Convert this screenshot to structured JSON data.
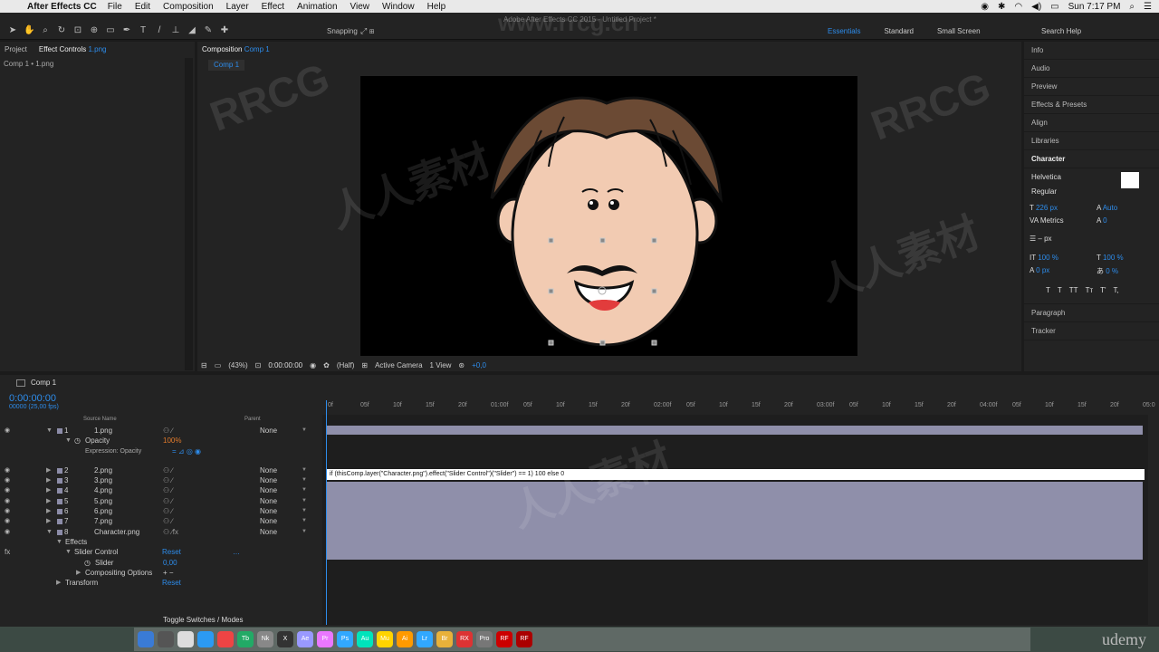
{
  "menubar": {
    "app_name": "After Effects CC",
    "items": [
      "File",
      "Edit",
      "Composition",
      "Layer",
      "Effect",
      "Animation",
      "View",
      "Window",
      "Help"
    ],
    "clock": "Sun 7:17 PM"
  },
  "toolbar": {
    "window_title": "Adobe After Effects CC 2015 - Untitled Project *",
    "snapping_label": "Snapping",
    "workspaces": [
      "Essentials",
      "Standard",
      "Small Screen"
    ],
    "active_workspace": "Essentials",
    "search_help": "Search Help"
  },
  "left_panel": {
    "tab_project": "Project",
    "tab_effect_controls": "Effect Controls",
    "tab_effect_controls_target": "1.png",
    "subtitle": "Comp 1 • 1.png"
  },
  "comp_panel": {
    "tab_label": "Composition",
    "tab_target": "Comp 1",
    "sub_tab": "Comp 1",
    "footer": {
      "zoom": "(43%)",
      "time": "0:00:00:00",
      "resolution": "(Half)",
      "camera": "Active Camera",
      "view": "1 View",
      "exposure": "+0,0"
    }
  },
  "right_panel": {
    "items": [
      "Info",
      "Audio",
      "Preview",
      "Effects & Presets",
      "Align",
      "Libraries"
    ],
    "character_header": "Character",
    "font_family": "Helvetica",
    "font_style": "Regular",
    "font_size": "226 px",
    "leading": "Auto",
    "kerning": "Metrics",
    "tracking": "0",
    "stroke_size": "– px",
    "vert_scale": "100 %",
    "horiz_scale": "100 %",
    "baseline": "0 px",
    "tsume": "0 %",
    "format_buttons": [
      "T",
      "T",
      "TT",
      "Tт",
      "T'",
      "T,"
    ],
    "paragraph": "Paragraph",
    "tracker": "Tracker"
  },
  "timeline": {
    "tab": "Comp 1",
    "timecode": "0:00:00:00",
    "fps": "00000 (25,00 fps)",
    "col_source_name": "Source Name",
    "col_parent": "Parent",
    "layers": [
      {
        "num": "1",
        "name": "1.png",
        "parent": "None",
        "open": true
      },
      {
        "num": "2",
        "name": "2.png",
        "parent": "None",
        "open": false
      },
      {
        "num": "3",
        "name": "3.png",
        "parent": "None",
        "open": false
      },
      {
        "num": "4",
        "name": "4.png",
        "parent": "None",
        "open": false
      },
      {
        "num": "5",
        "name": "5.png",
        "parent": "None",
        "open": false
      },
      {
        "num": "6",
        "name": "6.png",
        "parent": "None",
        "open": false
      },
      {
        "num": "7",
        "name": "7.png",
        "parent": "None",
        "open": false
      },
      {
        "num": "8",
        "name": "Character.png",
        "parent": "None",
        "open": true
      }
    ],
    "opacity_label": "Opacity",
    "opacity_value": "100%",
    "expression_label": "Expression: Opacity",
    "expression_text": "if (thisComp.layer(\"Character.png\").effect(\"Slider Control\")(\"Slider\") == 1) 100 else 0",
    "effects_label": "Effects",
    "slider_control_label": "Slider Control",
    "reset_label": "Reset",
    "slider_label": "Slider",
    "slider_value": "0,00",
    "compositing_options": "Compositing Options",
    "compositing_value": "+ −",
    "transform_label": "Transform",
    "ruler_ticks": [
      "0f",
      "05f",
      "10f",
      "15f",
      "20f",
      "01:00f",
      "05f",
      "10f",
      "15f",
      "20f",
      "02:00f",
      "05f",
      "10f",
      "15f",
      "20f",
      "03:00f",
      "05f",
      "10f",
      "15f",
      "20f",
      "04:00f",
      "05f",
      "10f",
      "15f",
      "20f",
      "05:0"
    ],
    "footer": "Toggle Switches / Modes"
  },
  "watermark": [
    "www.rrcg.cn",
    "RRCG",
    "人人素材"
  ],
  "dock_label": "udemy",
  "dock_apps": [
    "Finder",
    "Siri",
    "Calendar",
    "Safari",
    "Chrome",
    "Tb",
    "Nk",
    "X",
    "Ae",
    "Pr",
    "Ps",
    "Au",
    "Mu",
    "Ai",
    "Lr",
    "Br",
    "RX",
    "Pro",
    "RF",
    "RF"
  ]
}
